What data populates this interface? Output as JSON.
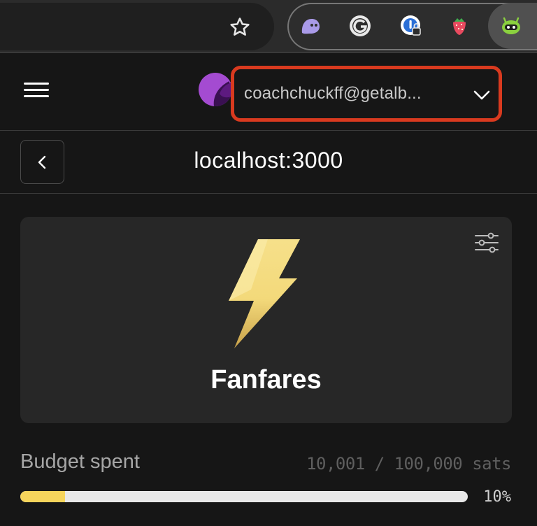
{
  "account": {
    "email": "coachchuckff@getalb..."
  },
  "site": {
    "title": "localhost:3000"
  },
  "app": {
    "name": "Fanfares"
  },
  "budget": {
    "label": "Budget spent",
    "amount_text": "10,001 / 100,000 sats",
    "percent_text": "10%",
    "spent_fraction": 0.1
  },
  "colors": {
    "accent_border": "#d93a1f",
    "progress_fill": "#f6d55c",
    "avatar_bg": "#a44bd1"
  },
  "icons": {
    "toolbar": [
      "star-icon",
      "ghost-extension-icon",
      "grammarly-extension-icon",
      "password-manager-extension-icon",
      "strawberry-extension-icon",
      "alby-extension-icon"
    ],
    "popup": [
      "menu-icon",
      "chevron-down-icon",
      "chevron-left-icon",
      "settings-sliders-icon",
      "lightning-bolt-icon"
    ]
  }
}
